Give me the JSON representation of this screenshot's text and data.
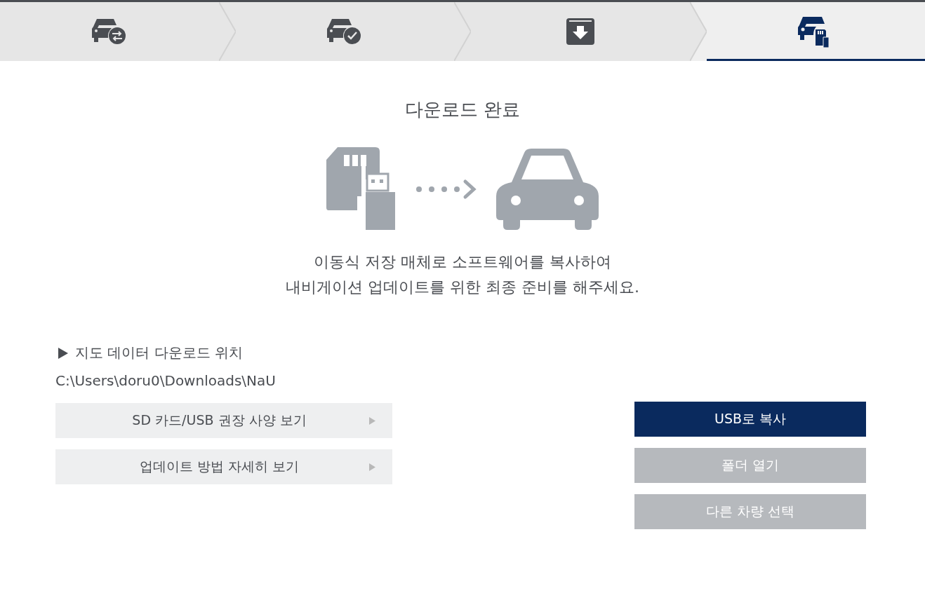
{
  "steps": [
    {
      "kind": "car-swap",
      "selected": false
    },
    {
      "kind": "car-check",
      "selected": false
    },
    {
      "kind": "download",
      "selected": false
    },
    {
      "kind": "car-card",
      "selected": true
    }
  ],
  "title": "다운로드 완료",
  "message": [
    "이동식 저장 매체로 소프트웨어를 복사하여",
    "내비게이션 업데이트를 위한 최종 준비를 해주세요."
  ],
  "location": {
    "label": "지도 데이터 다운로드 위치",
    "path": "C:\\Users\\doru0\\Downloads\\NaU"
  },
  "links": [
    "SD 카드/USB 권장 사양 보기",
    "업데이트 방법 자세히 보기"
  ],
  "actions": [
    {
      "label": "USB로 복사",
      "kind": "primary"
    },
    {
      "label": "폴더 열기",
      "kind": "secondary"
    },
    {
      "label": "다른 차량 선택",
      "kind": "secondary"
    }
  ]
}
